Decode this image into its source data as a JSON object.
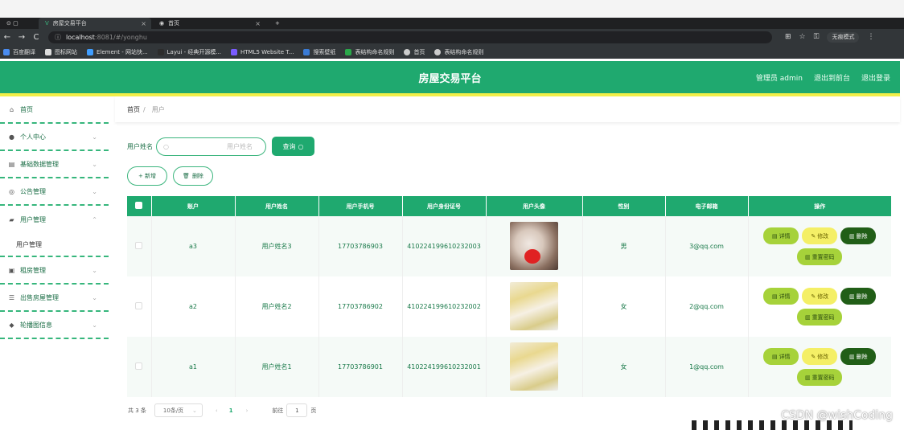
{
  "browser": {
    "tabs": [
      {
        "label": "房屋交易平台",
        "active": true
      },
      {
        "label": "首页",
        "active": false
      }
    ],
    "url_host": "localhost",
    "url_rest": ":8081/#/yonghu",
    "profile_label": "无痕模式",
    "bookmarks": [
      "百度翻译",
      "图标网站",
      "Element - 网站快...",
      "Layui - 经典开源模...",
      "HTML5 Website T...",
      "搜索壁纸",
      "表结构命名规则",
      "首页",
      "表结构命名规则"
    ]
  },
  "header": {
    "title": "房屋交易平台",
    "links": [
      "管理员 admin",
      "退出到前台",
      "退出登录"
    ]
  },
  "sidebar": {
    "items": [
      {
        "label": "首页",
        "icon": "home-icon",
        "expandable": false
      },
      {
        "label": "个人中心",
        "icon": "user-icon",
        "expandable": true
      },
      {
        "label": "基础数据管理",
        "icon": "database-icon",
        "expandable": true
      },
      {
        "label": "公告管理",
        "icon": "globe-icon",
        "expandable": true
      },
      {
        "label": "用户管理",
        "icon": "users-icon",
        "expandable": true
      },
      {
        "label": "租房管理",
        "icon": "clipboard-icon",
        "expandable": true
      },
      {
        "label": "出售房屋管理",
        "icon": "list-icon",
        "expandable": true
      },
      {
        "label": "轮播图信息",
        "icon": "image-icon",
        "expandable": true
      }
    ],
    "sub_item": "用户管理"
  },
  "breadcrumb": {
    "home": "首页",
    "separator": "/",
    "current": "用户"
  },
  "search": {
    "label": "用户姓名",
    "placeholder": "用户姓名",
    "button": "查询"
  },
  "actions": {
    "add": "+ 新增",
    "delete": "删除"
  },
  "table": {
    "headers": [
      "账户",
      "用户姓名",
      "用户手机号",
      "用户身份证号",
      "用户头像",
      "性别",
      "电子邮箱",
      "操作"
    ],
    "rows": [
      {
        "account": "a3",
        "name": "用户姓名3",
        "phone": "17703786903",
        "idcard": "410224199610232003",
        "gender": "男",
        "email": "3@qq.com"
      },
      {
        "account": "a2",
        "name": "用户姓名2",
        "phone": "17703786902",
        "idcard": "410224199610232002",
        "gender": "女",
        "email": "2@qq.com"
      },
      {
        "account": "a1",
        "name": "用户姓名1",
        "phone": "17703786901",
        "idcard": "410224199610232001",
        "gender": "女",
        "email": "1@qq.com"
      }
    ],
    "op_labels": {
      "detail": "详情",
      "modify": "修改",
      "delete": "删除",
      "reset": "重置密码"
    }
  },
  "pager": {
    "total": "共 3 条",
    "page_size": "10条/页",
    "current_page": "1",
    "goto_label": "前往",
    "goto_value": "1",
    "page_unit": "页"
  },
  "watermark": "CSDN @wishCoding",
  "colors": {
    "primary": "#1fa96f",
    "accent_line": "#f1ef47",
    "detail_btn": "#a6d23a",
    "modify_btn": "#f4ef66",
    "delete_btn": "#215e17"
  }
}
